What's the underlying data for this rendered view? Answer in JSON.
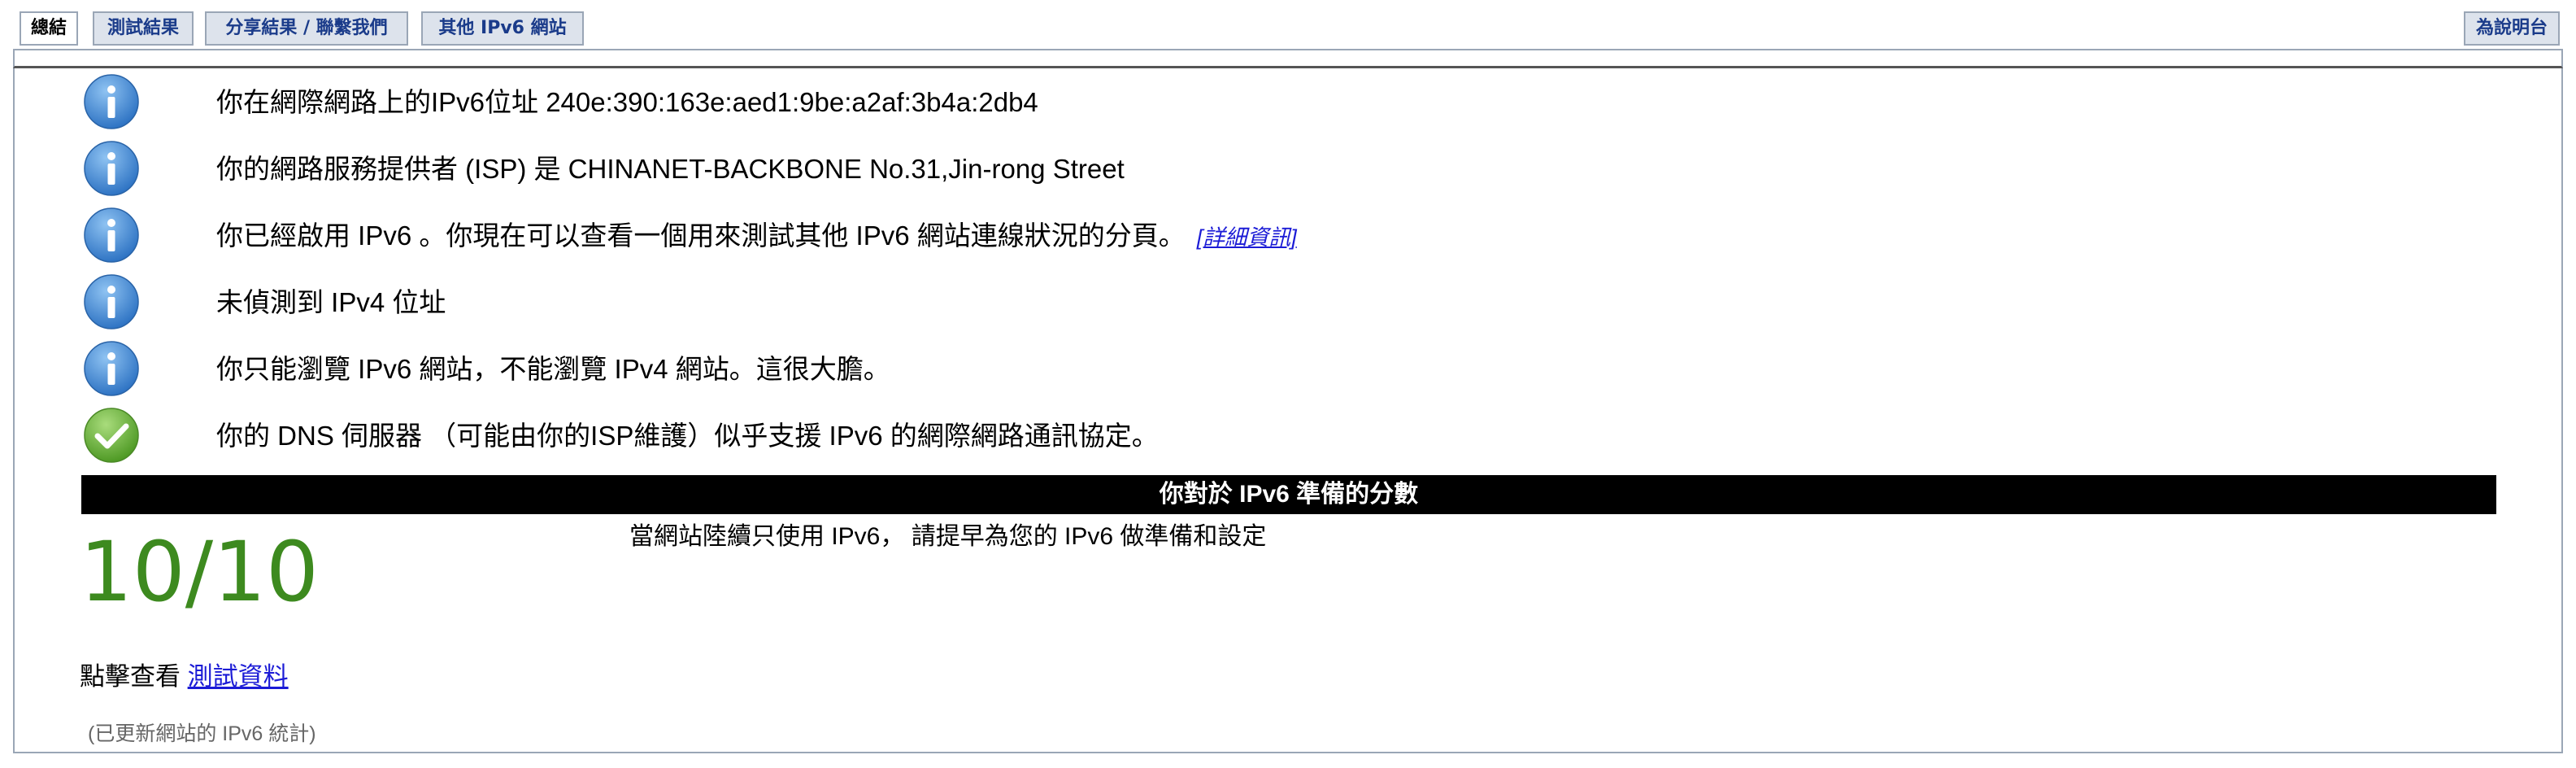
{
  "tabs": [
    {
      "label": "總結",
      "active": true
    },
    {
      "label": "測試結果",
      "active": false
    },
    {
      "label": "分享結果 / 聯繫我們",
      "active": false
    },
    {
      "label": "其他 IPv6 網站",
      "active": false
    }
  ],
  "help_tab": {
    "label": "為說明台"
  },
  "results": [
    {
      "icon": "info-icon",
      "text": "你在網際網路上的IPv6位址 240e:390:163e:aed1:9be:a2af:3b4a:2db4"
    },
    {
      "icon": "info-icon",
      "text": "你的網路服務提供者 (ISP) 是 CHINANET-BACKBONE No.31,Jin-rong Street"
    },
    {
      "icon": "info-icon",
      "text": "你已經啟用 IPv6 。你現在可以查看一個用來測試其他 IPv6 網站連線狀況的分頁。",
      "link": "[詳細資訊]"
    },
    {
      "icon": "info-icon",
      "text": "未偵測到 IPv4 位址"
    },
    {
      "icon": "info-icon",
      "text": "你只能瀏覽 IPv6 網站，不能瀏覽 IPv4 網站。這很大膽。"
    },
    {
      "icon": "check-icon",
      "text": "你的 DNS 伺服器 （可能由你的ISP維護）似乎支援 IPv6 的網際網路通訊協定。"
    }
  ],
  "score_section": {
    "header": "你對於 IPv6 準備的分數",
    "score": "10/10",
    "message": "當網站陸續只使用 IPv6， 請提早為您的 IPv6 做準備和設定"
  },
  "view_data": {
    "prefix": "點擊查看",
    "link": "測試資料"
  },
  "stats_note": "(已更新網站的 IPv6 統計)",
  "colors": {
    "info_blue": "#4a90d9",
    "check_green": "#6ab43e",
    "score_green": "#3d8a1f",
    "link_blue": "#1b1bd6"
  }
}
